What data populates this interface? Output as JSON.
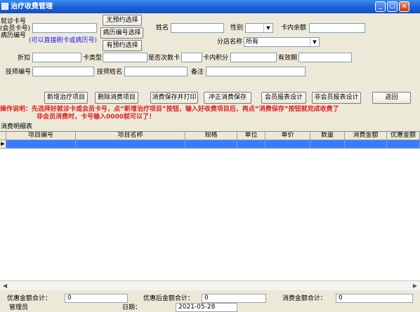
{
  "window": {
    "title": "治疗收费管理",
    "controls": [
      "_",
      "□",
      "×"
    ]
  },
  "form": {
    "card_label_line1": "就诊卡号",
    "card_label_line2": "(会员卡号)",
    "card_label_line3": "病历编号",
    "card_hint": "(可以直接刷卡或病历号)",
    "card_value": "",
    "btn_no_reservation": "无预约选择",
    "btn_record_select": "病历编号选择",
    "btn_reservation": "有预约选择",
    "name_label": "姓名",
    "name_value": "",
    "gender_label": "性别",
    "gender_value": "",
    "balance_label": "卡内余额",
    "balance_value": "",
    "branch_label": "分店名称",
    "branch_value": "所有",
    "discount_label": "折扣",
    "discount_value": "",
    "card_type_label": "卡类型",
    "card_type_value": "",
    "count_card_label": "是否次数卡",
    "count_card_value": "",
    "points_label": "卡内积分",
    "points_value": "",
    "expiry_label": "有效期",
    "expiry_value": "",
    "tech_id_label": "技师编号",
    "tech_id_value": "",
    "tech_name_label": "技师姓名",
    "tech_name_value": "",
    "remark_label": "备注",
    "remark_value": ""
  },
  "toolbar": {
    "add_item": "新增治疗项目",
    "delete_item": "删除消费项目",
    "save_print": "消费保存并打印",
    "correct_save": "冲正消费保存",
    "member_report": "会员报表设计",
    "nonmember_report": "非会员报表设计",
    "back": "返回"
  },
  "instructions": {
    "line1": "操作说明：先选择好就诊卡或会员卡号，点“新增治疗项目”按钮，输入好收费项目后，再点“消费保存”按钮就完成收费了",
    "line2": "非会员消费时，卡号输入0000就可以了！"
  },
  "grid": {
    "caption": "消费明细表",
    "columns": [
      "项目编号",
      "项目名称",
      "规格",
      "单位",
      "单价",
      "数量",
      "消费金额",
      "优惠金额"
    ],
    "row_indicator": "▶"
  },
  "footer": {
    "discount_total_label": "优惠金额合计：",
    "discount_total_value": "0",
    "after_discount_label": "优惠后金额合计：",
    "after_discount_value": "0",
    "consume_total_label": "消费金额合计：",
    "consume_total_value": "0",
    "user_label": "管理员",
    "date_label": "日期：",
    "date_value": "2021-05-28"
  }
}
